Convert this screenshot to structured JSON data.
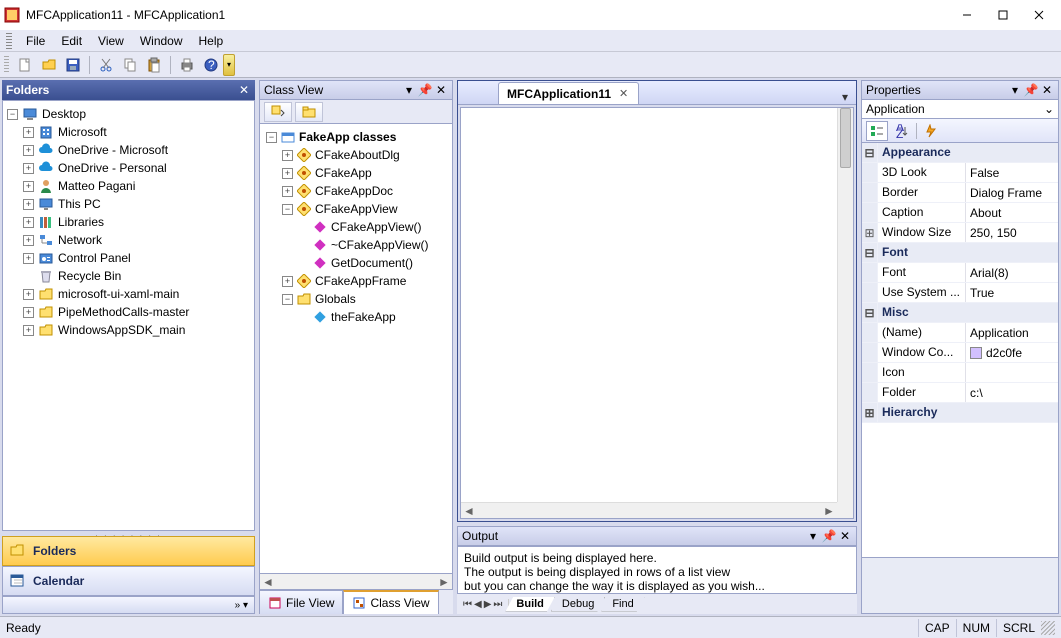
{
  "title": "MFCApplication11 - MFCApplication1",
  "menu": [
    "File",
    "Edit",
    "View",
    "Window",
    "Help"
  ],
  "toolbar_icons": [
    "new",
    "open",
    "save",
    "cut",
    "copy",
    "paste",
    "print",
    "help"
  ],
  "folders": {
    "title": "Folders",
    "root": "Desktop",
    "items": [
      {
        "label": "Microsoft",
        "icon": "building"
      },
      {
        "label": "OneDrive - Microsoft",
        "icon": "cloud"
      },
      {
        "label": "OneDrive - Personal",
        "icon": "cloud"
      },
      {
        "label": "Matteo Pagani",
        "icon": "person"
      },
      {
        "label": "This PC",
        "icon": "pc"
      },
      {
        "label": "Libraries",
        "icon": "libs"
      },
      {
        "label": "Network",
        "icon": "net"
      },
      {
        "label": "Control Panel",
        "icon": "cpl"
      },
      {
        "label": "Recycle Bin",
        "icon": "bin",
        "noexp": true
      },
      {
        "label": "microsoft-ui-xaml-main",
        "icon": "folder"
      },
      {
        "label": "PipeMethodCalls-master",
        "icon": "folder"
      },
      {
        "label": "WindowsAppSDK_main",
        "icon": "folder"
      }
    ],
    "navbtns": [
      {
        "label": "Folders",
        "icon": "folder",
        "active": true
      },
      {
        "label": "Calendar",
        "icon": "calendar",
        "active": false
      }
    ]
  },
  "classview": {
    "title": "Class View",
    "root": "FakeApp classes",
    "nodes": [
      {
        "label": "CFakeAboutDlg",
        "icon": "class",
        "depth": 1,
        "exp": "+"
      },
      {
        "label": "CFakeApp",
        "icon": "class",
        "depth": 1,
        "exp": "+"
      },
      {
        "label": "CFakeAppDoc",
        "icon": "class",
        "depth": 1,
        "exp": "+"
      },
      {
        "label": "CFakeAppView",
        "icon": "class",
        "depth": 1,
        "exp": "-"
      },
      {
        "label": "CFakeAppView()",
        "icon": "method",
        "depth": 2
      },
      {
        "label": "~CFakeAppView()",
        "icon": "method",
        "depth": 2
      },
      {
        "label": "GetDocument()",
        "icon": "method",
        "depth": 2
      },
      {
        "label": "CFakeAppFrame",
        "icon": "class",
        "depth": 1,
        "exp": "+"
      },
      {
        "label": "Globals",
        "icon": "folder",
        "depth": 1,
        "exp": "-"
      },
      {
        "label": "theFakeApp",
        "icon": "var",
        "depth": 2
      }
    ],
    "tabs": [
      {
        "label": "File View",
        "icon": "fileview"
      },
      {
        "label": "Class View",
        "icon": "classview",
        "sel": true
      }
    ]
  },
  "doc": {
    "tab": "MFCApplication11"
  },
  "output": {
    "title": "Output",
    "lines": [
      "Build output is being displayed here.",
      "The output is being displayed in rows of a list view",
      "but you can change the way it is displayed as you wish..."
    ],
    "tabs": [
      "Build",
      "Debug",
      "Find"
    ]
  },
  "properties": {
    "title": "Properties",
    "combo": "Application",
    "groups": [
      {
        "cat": "Appearance",
        "exp": "-",
        "rows": [
          {
            "name": "3D Look",
            "val": "False"
          },
          {
            "name": "Border",
            "val": "Dialog Frame"
          },
          {
            "name": "Caption",
            "val": "About"
          },
          {
            "name": "Window Size",
            "val": "250, 150",
            "exp": "+"
          }
        ]
      },
      {
        "cat": "Font",
        "exp": "-",
        "rows": [
          {
            "name": "Font",
            "val": "Arial(8)"
          },
          {
            "name": "Use System ...",
            "val": "True"
          }
        ]
      },
      {
        "cat": "Misc",
        "exp": "-",
        "rows": [
          {
            "name": "(Name)",
            "val": "Application"
          },
          {
            "name": "Window Co...",
            "val": "d2c0fe",
            "swatch": "#d2c0fe"
          },
          {
            "name": "Icon",
            "val": ""
          },
          {
            "name": "Folder",
            "val": "c:\\"
          }
        ]
      },
      {
        "cat": "Hierarchy",
        "exp": "+",
        "rows": []
      }
    ]
  },
  "status": {
    "ready": "Ready",
    "cells": [
      "CAP",
      "NUM",
      "SCRL"
    ]
  }
}
